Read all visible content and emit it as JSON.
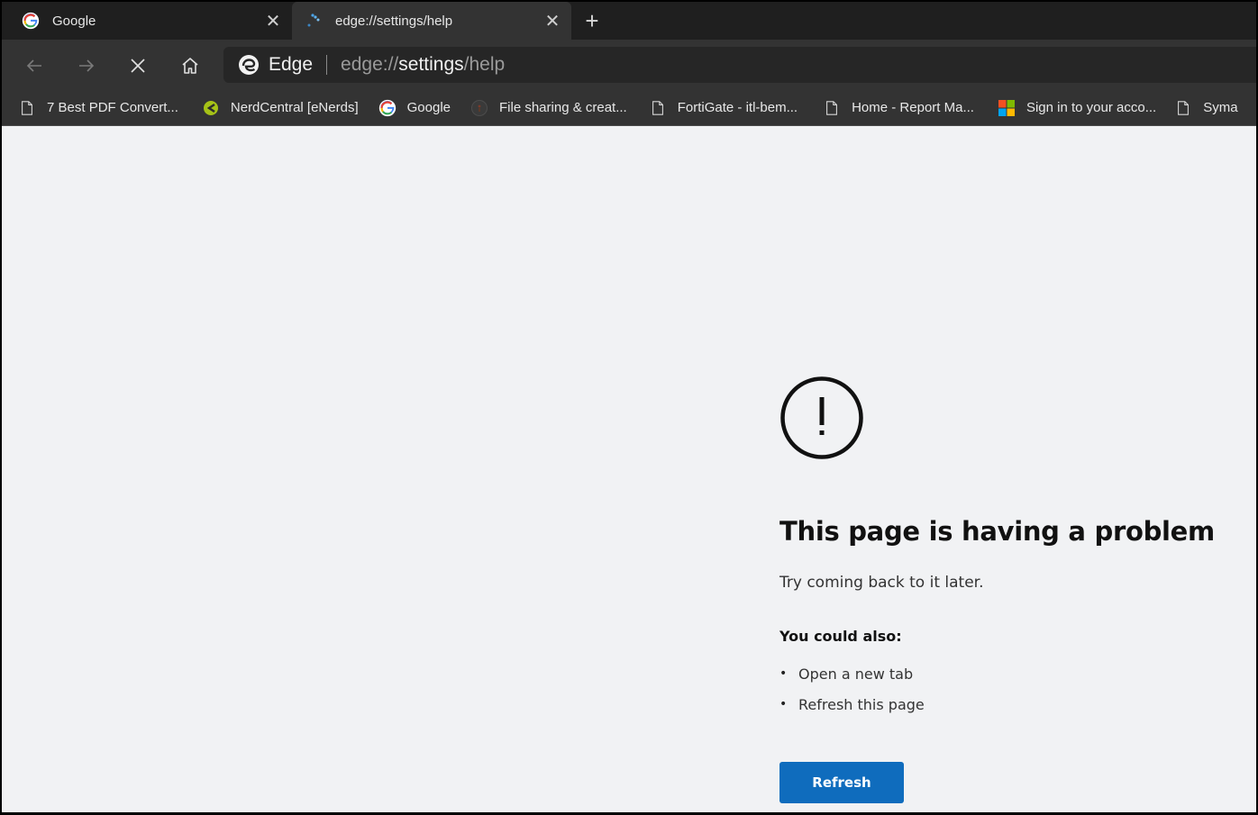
{
  "tabs": [
    {
      "title": "Google",
      "favicon": "google-g-icon",
      "active": false
    },
    {
      "title": "edge://settings/help",
      "favicon": "loading-spinner-icon",
      "active": true
    }
  ],
  "tabstrip": {
    "new_tab_glyph": "+",
    "close_glyph": "✕"
  },
  "toolbar": {
    "back_icon": "arrow-left-icon",
    "forward_icon": "arrow-right-icon",
    "stop_icon": "close-icon",
    "home_icon": "home-icon"
  },
  "address_bar": {
    "badge_label": "Edge",
    "url_prefix": "edge://",
    "url_host": "settings",
    "url_path": "/help"
  },
  "bookmarks": [
    {
      "label": "7 Best PDF Convert...",
      "icon": "page-icon"
    },
    {
      "label": "NerdCentral [eNerds]",
      "icon": "nerdcentral-icon"
    },
    {
      "label": "Google",
      "icon": "google-g-icon"
    },
    {
      "label": "File sharing & creat...",
      "icon": "circle-favicon-icon"
    },
    {
      "label": "FortiGate - itl-bem...",
      "icon": "page-icon"
    },
    {
      "label": "Home - Report Ma...",
      "icon": "page-icon"
    },
    {
      "label": "Sign in to your acco...",
      "icon": "microsoft-icon"
    },
    {
      "label": "Syma",
      "icon": "page-icon"
    }
  ],
  "error_page": {
    "icon": "exclamation-circle-icon",
    "heading": "This page is having a problem",
    "subtext": "Try coming back to it later.",
    "also_heading": "You could also:",
    "suggestions": [
      "Open a new tab",
      "Refresh this page"
    ],
    "bullet": "•",
    "refresh_label": "Refresh"
  },
  "colors": {
    "accent": "#0f6cbd",
    "tabstrip_bg": "#1f1f1f",
    "toolbar_bg": "#333333",
    "content_bg": "#f1f2f4"
  }
}
